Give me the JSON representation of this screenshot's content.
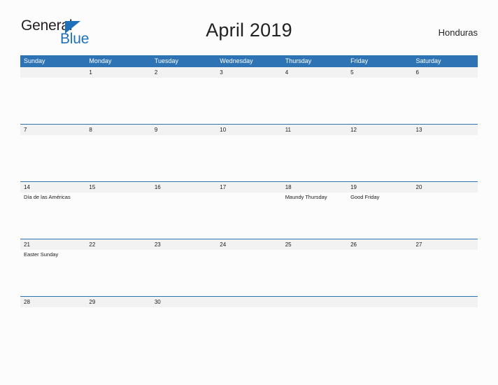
{
  "brand": {
    "name_part1": "General",
    "name_part2": "Blue",
    "accent_color": "#1f70b8"
  },
  "header": {
    "title": "April 2019",
    "country": "Honduras"
  },
  "calendar": {
    "header_color": "#2e74b5",
    "date_band_color": "#f2f2f2",
    "weekdays": [
      "Sunday",
      "Monday",
      "Tuesday",
      "Wednesday",
      "Thursday",
      "Friday",
      "Saturday"
    ],
    "weeks": [
      [
        {
          "date": "",
          "holiday": ""
        },
        {
          "date": "1",
          "holiday": ""
        },
        {
          "date": "2",
          "holiday": ""
        },
        {
          "date": "3",
          "holiday": ""
        },
        {
          "date": "4",
          "holiday": ""
        },
        {
          "date": "5",
          "holiday": ""
        },
        {
          "date": "6",
          "holiday": ""
        }
      ],
      [
        {
          "date": "7",
          "holiday": ""
        },
        {
          "date": "8",
          "holiday": ""
        },
        {
          "date": "9",
          "holiday": ""
        },
        {
          "date": "10",
          "holiday": ""
        },
        {
          "date": "11",
          "holiday": ""
        },
        {
          "date": "12",
          "holiday": ""
        },
        {
          "date": "13",
          "holiday": ""
        }
      ],
      [
        {
          "date": "14",
          "holiday": "Día de las Américas"
        },
        {
          "date": "15",
          "holiday": ""
        },
        {
          "date": "16",
          "holiday": ""
        },
        {
          "date": "17",
          "holiday": ""
        },
        {
          "date": "18",
          "holiday": "Maundy Thursday"
        },
        {
          "date": "19",
          "holiday": "Good Friday"
        },
        {
          "date": "20",
          "holiday": ""
        }
      ],
      [
        {
          "date": "21",
          "holiday": "Easter Sunday"
        },
        {
          "date": "22",
          "holiday": ""
        },
        {
          "date": "23",
          "holiday": ""
        },
        {
          "date": "24",
          "holiday": ""
        },
        {
          "date": "25",
          "holiday": ""
        },
        {
          "date": "26",
          "holiday": ""
        },
        {
          "date": "27",
          "holiday": ""
        }
      ],
      [
        {
          "date": "28",
          "holiday": ""
        },
        {
          "date": "29",
          "holiday": ""
        },
        {
          "date": "30",
          "holiday": ""
        },
        {
          "date": "",
          "holiday": ""
        },
        {
          "date": "",
          "holiday": ""
        },
        {
          "date": "",
          "holiday": ""
        },
        {
          "date": "",
          "holiday": ""
        }
      ]
    ]
  }
}
